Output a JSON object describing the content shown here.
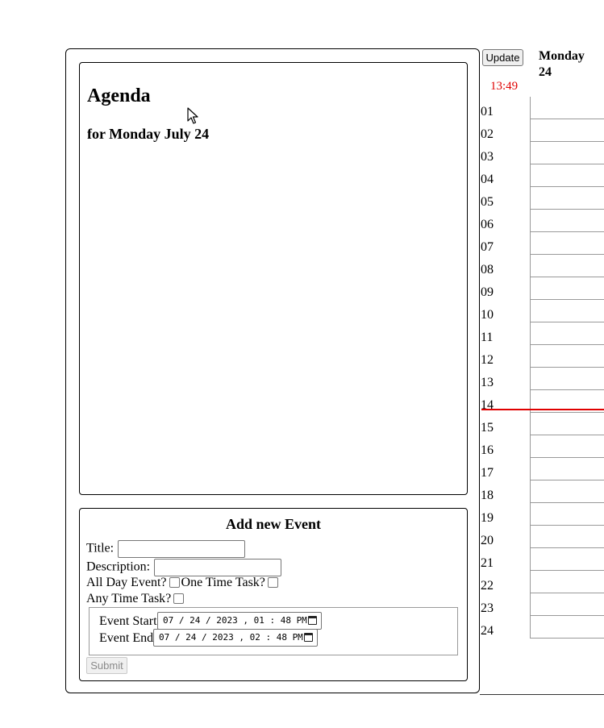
{
  "agenda": {
    "title": "Agenda",
    "subtitle": "for Monday July 24"
  },
  "event_form": {
    "heading": "Add new Event",
    "title_label": "Title:",
    "title_value": "",
    "description_label": "Description:",
    "description_value": "",
    "all_day_label": "All Day Event?",
    "one_time_label": "One Time Task?",
    "any_time_label": "Any Time Task?",
    "start_label": "Event Start",
    "start_value": "07 / 24 / 2023 ,  01 : 48  PM",
    "end_label": "Event End",
    "end_value": "07 / 24 / 2023 ,  02 : 48  PM",
    "submit_label": "Submit"
  },
  "calendar": {
    "update_label": "Update",
    "current_time": "13:49",
    "day_name": "Monday",
    "day_number": "24",
    "hours": [
      "01",
      "02",
      "03",
      "04",
      "05",
      "06",
      "07",
      "08",
      "09",
      "10",
      "11",
      "12",
      "13",
      "14",
      "15",
      "16",
      "17",
      "18",
      "19",
      "20",
      "21",
      "22",
      "23",
      "24"
    ],
    "now_line_color": "#e00000"
  }
}
